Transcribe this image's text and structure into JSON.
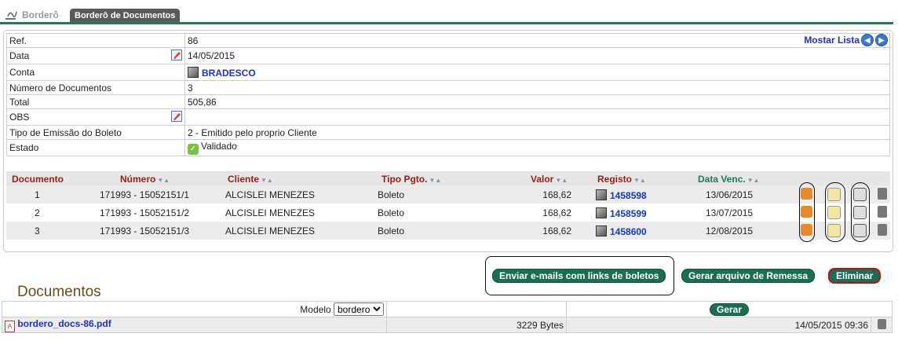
{
  "tabs": {
    "inactive": "Borderô",
    "active": "Borderô de Documentos"
  },
  "info": {
    "mostrar_lista": "Mostar Lista",
    "rows": [
      {
        "label": "Ref.",
        "value": "86"
      },
      {
        "label": "Data",
        "value": "14/05/2015"
      },
      {
        "label": "Conta",
        "value": "BRADESCO"
      },
      {
        "label": "Número de Documentos",
        "value": "3"
      },
      {
        "label": "Total",
        "value": "505,86"
      },
      {
        "label": "OBS",
        "value": ""
      },
      {
        "label": "Tipo de Emissão do Boleto",
        "value": "2 - Emitido pelo proprio Cliente"
      },
      {
        "label": "Estado",
        "value": "Validado"
      }
    ]
  },
  "docs": {
    "headers": {
      "documento": "Documento",
      "numero": "Número",
      "cliente": "Cliente",
      "tipo": "Tipo Pgto.",
      "valor": "Valor",
      "registo": "Registo",
      "venc": "Data Venc."
    },
    "rows": [
      {
        "doc": "1",
        "numero": "171993 - 15052151/1",
        "cliente": "ALCISLEI MENEZES",
        "tipo": "Boleto",
        "valor": "168,62",
        "registo": "1458598",
        "venc": "13/06/2015"
      },
      {
        "doc": "2",
        "numero": "171993 - 15052151/2",
        "cliente": "ALCISLEI MENEZES",
        "tipo": "Boleto",
        "valor": "168,62",
        "registo": "1458599",
        "venc": "13/07/2015"
      },
      {
        "doc": "3",
        "numero": "171993 - 15052151/3",
        "cliente": "ALCISLEI MENEZES",
        "tipo": "Boleto",
        "valor": "168,62",
        "registo": "1458600",
        "venc": "12/08/2015"
      }
    ]
  },
  "actions": {
    "enviar": "Enviar e-mails com links de boletos",
    "gerar_remessa": "Gerar arquivo de Remessa",
    "eliminar": "Eliminar"
  },
  "documentos": {
    "title": "Documentos",
    "modelo_label": "Modelo",
    "modelo_value": "bordero",
    "gerar": "Gerar",
    "file": {
      "name": "bordero_docs-86.pdf",
      "size": "3229 Bytes",
      "date": "14/05/2015 09:36"
    }
  }
}
